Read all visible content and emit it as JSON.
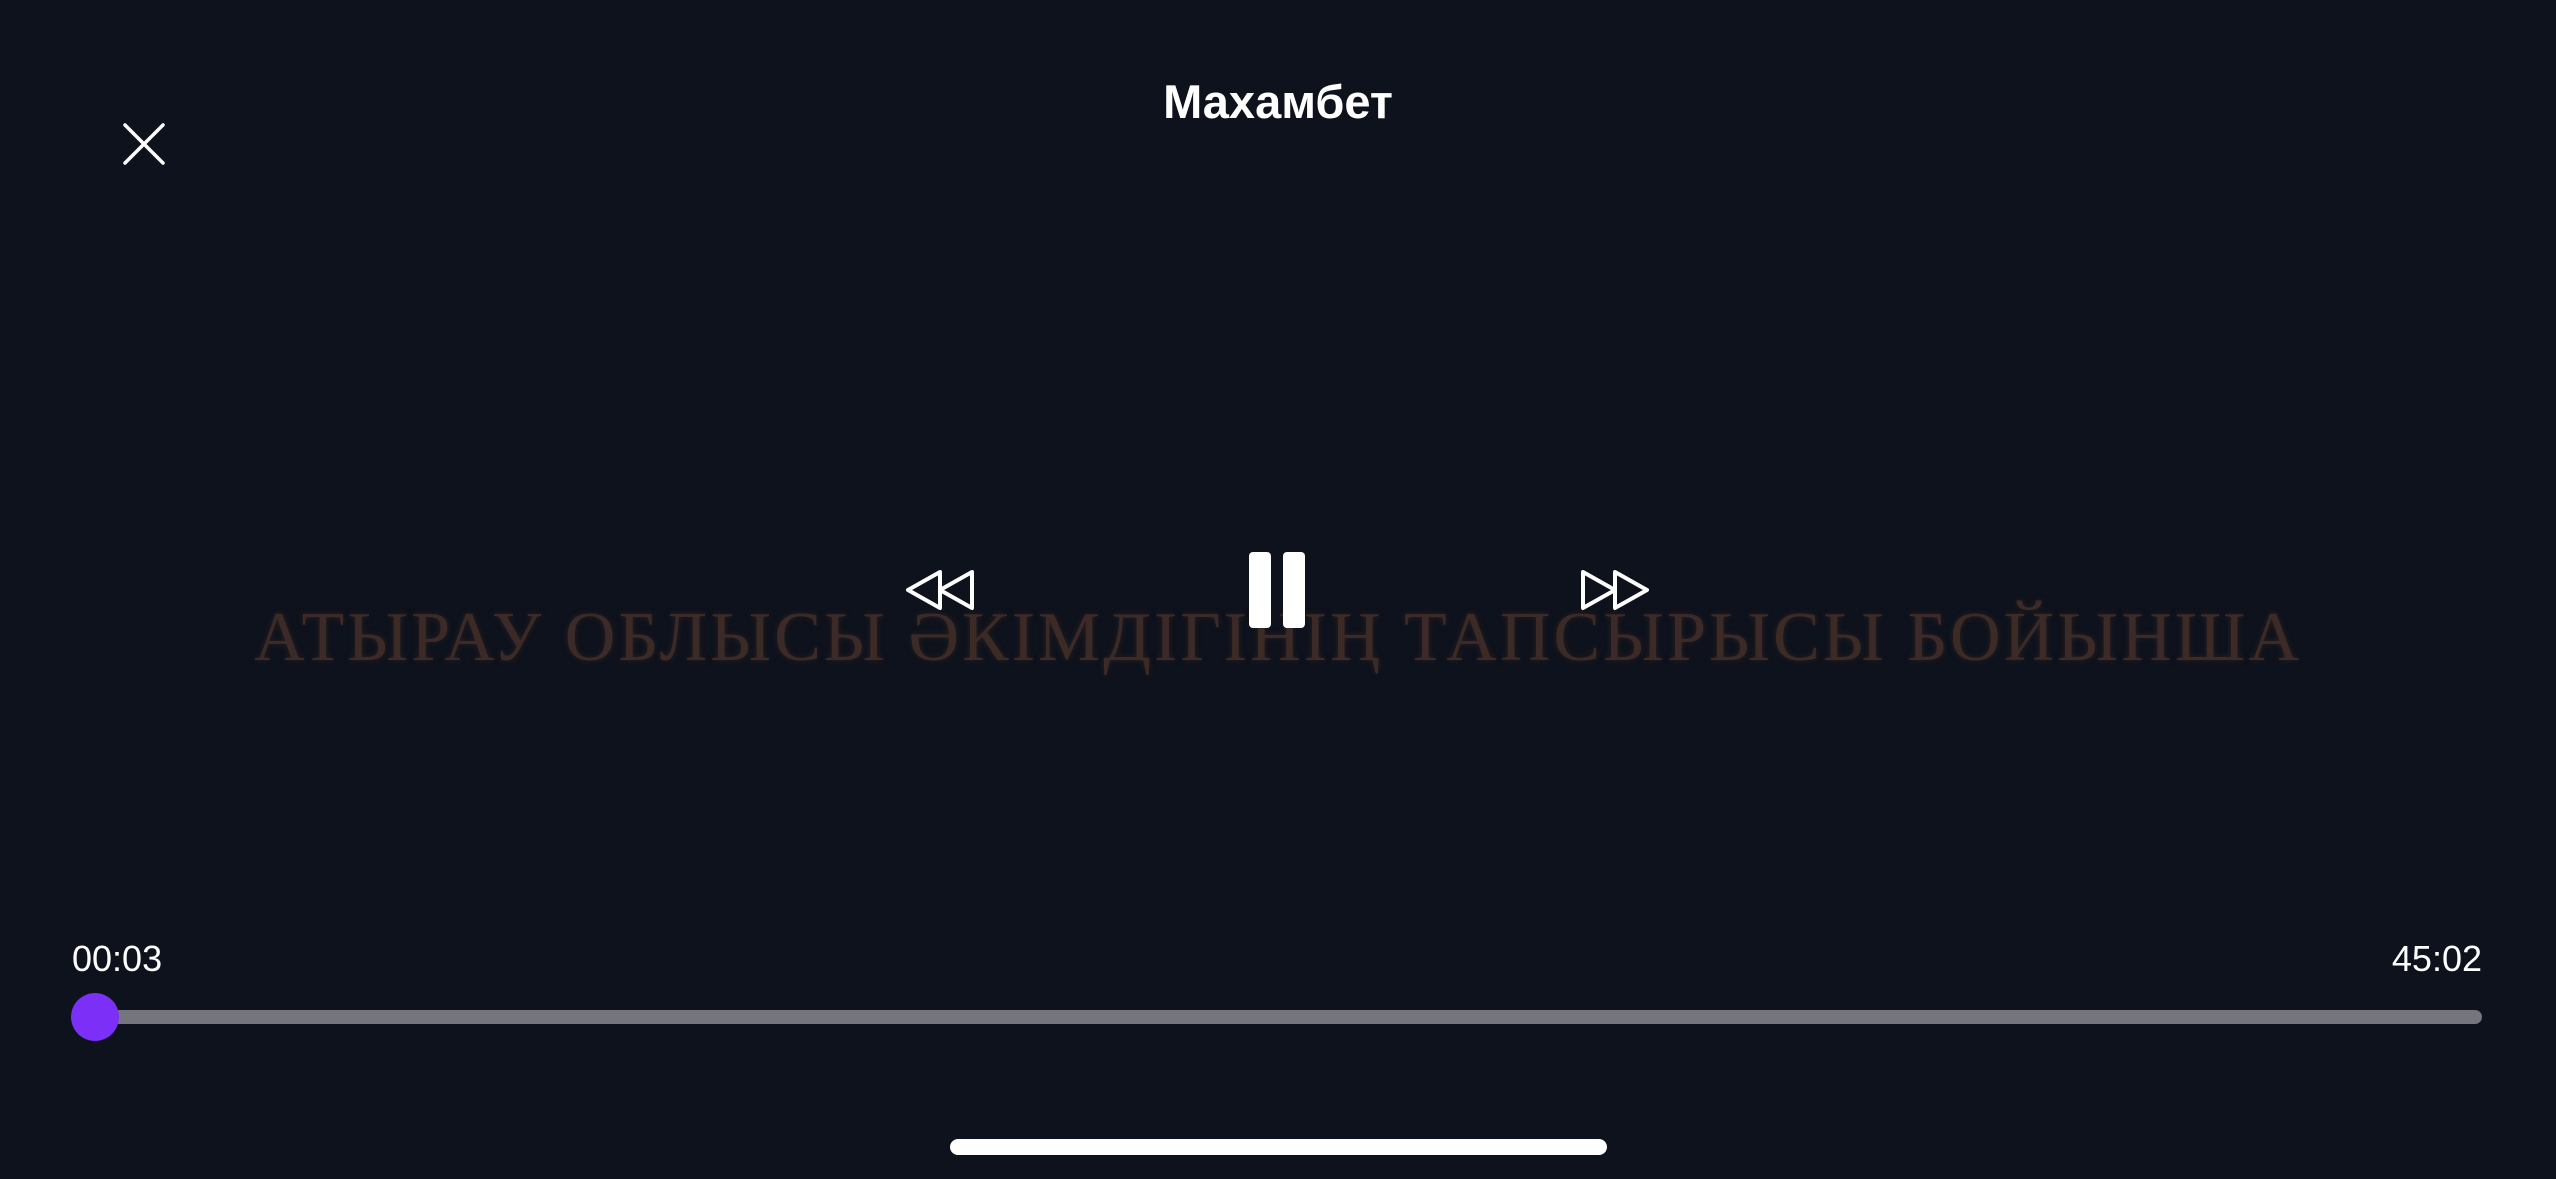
{
  "player": {
    "title": "Махамбет",
    "video_caption": "АТЫРАУ ОБЛЫСЫ ӘКІМДІГІНІҢ ТАПСЫРЫСЫ БОЙЫНША",
    "elapsed": "00:03",
    "duration": "45:02",
    "progress_fraction": 0.0011,
    "accent_color": "#7b2ff7",
    "track_color": "#75757e",
    "background_color": "#0e121c"
  },
  "icons": {
    "close": "close-icon",
    "rewind": "rewind-icon",
    "pause": "pause-icon",
    "forward": "fast-forward-icon"
  }
}
